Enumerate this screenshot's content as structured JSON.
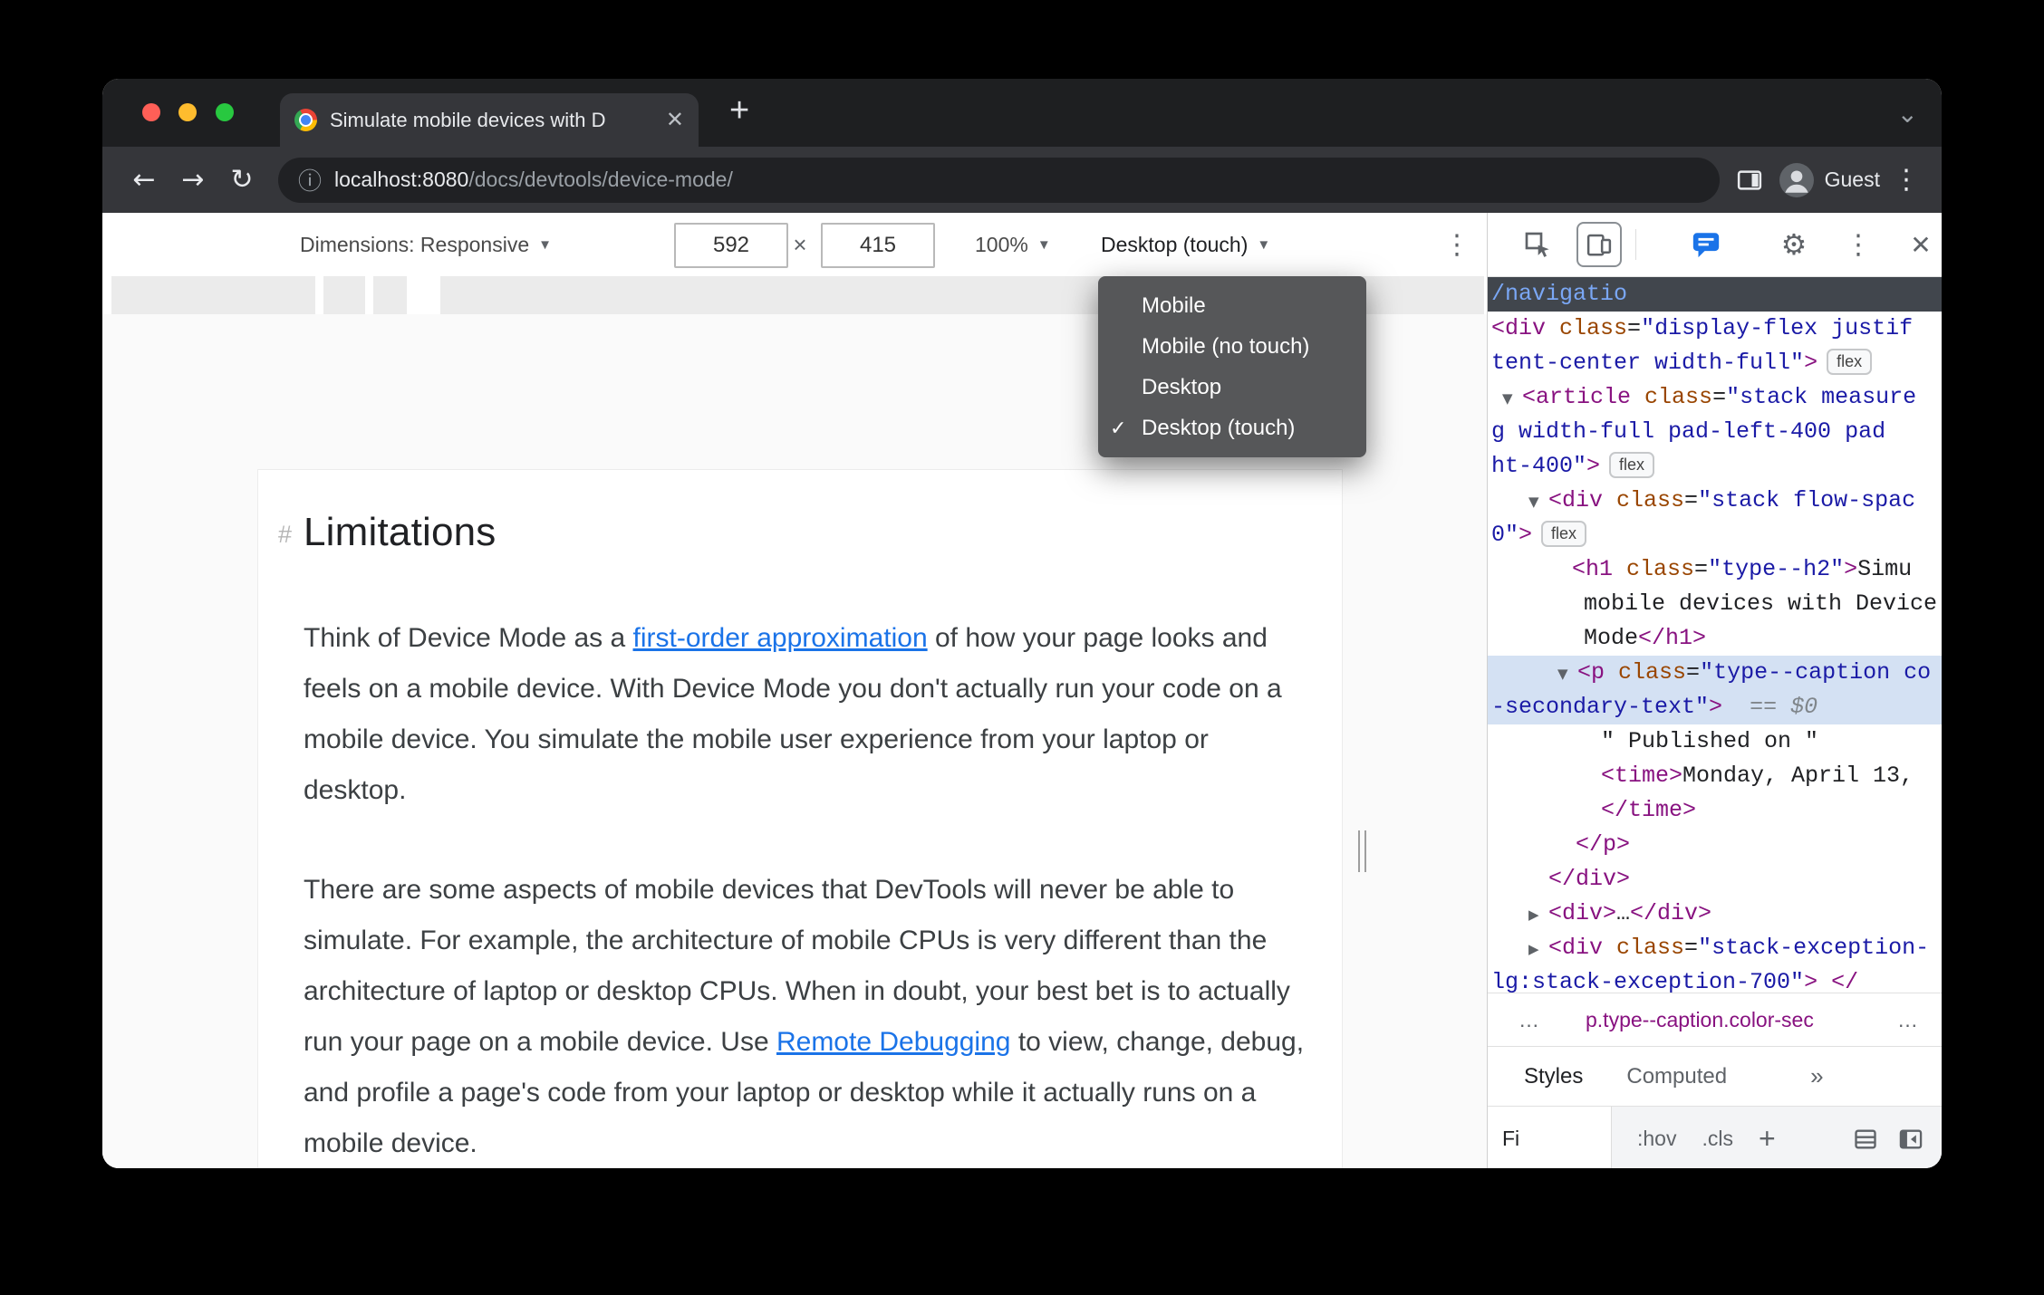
{
  "icons": {
    "close": "✕",
    "plus": "+",
    "chevron_down": "⌄",
    "back": "←",
    "forward": "→",
    "reload": "↻",
    "kebab": "⋮",
    "info": "ⓘ",
    "caret": "▾",
    "gear": "⚙",
    "check": "✓",
    "ellipsis": "…",
    "times_small": "✕"
  },
  "window": {
    "tab_title": "Simulate mobile devices with D",
    "url_host": "localhost:8080",
    "url_path": "/docs/devtools/device-mode/",
    "guest_label": "Guest"
  },
  "device_toolbar": {
    "dimensions_label": "Dimensions: Responsive",
    "width_value": "592",
    "multiply": "×",
    "height_value": "415",
    "zoom_value": "100%",
    "device_type_value": "Desktop (touch)"
  },
  "dropdown": {
    "items": [
      {
        "label": "Mobile",
        "checked": false
      },
      {
        "label": "Mobile (no touch)",
        "checked": false
      },
      {
        "label": "Desktop",
        "checked": false
      },
      {
        "label": "Desktop (touch)",
        "checked": true
      }
    ]
  },
  "article": {
    "heading_hash": "#",
    "heading": "Limitations",
    "p1_before": "Think of Device Mode as a ",
    "p1_link": "first-order approximation",
    "p1_after": " of how your page looks and feels on a mobile device. With Device Mode you don't actually run your code on a mobile device. You simulate the mobile user experience from your laptop or desktop.",
    "p2_before": "There are some aspects of mobile devices that DevTools will never be able to simulate. For example, the architecture of mobile CPUs is very different than the architecture of laptop or desktop CPUs. When in doubt, your best bet is to actually run your page on a mobile device. Use ",
    "p2_link": "Remote Debugging",
    "p2_after": " to view, change, debug, and profile a page's code from your laptop or desktop while it actually runs on a mobile device."
  },
  "elements_panel": {
    "colors": {
      "tag": "#881280",
      "attribute": "#994500",
      "value": "#1a1aa6",
      "selected_bg": "#d4e1f3",
      "accent": "#1a73e8"
    },
    "rows": [
      {
        "i": 4,
        "dark": true,
        "segs": [
          [
            "d",
            "/navigatio"
          ]
        ]
      },
      {
        "i": 4,
        "segs": [
          [
            "g",
            "<div"
          ],
          [
            "p",
            " "
          ],
          [
            "a",
            "class"
          ],
          [
            "p",
            "="
          ],
          [
            "v",
            "\"display-flex justif"
          ]
        ]
      },
      {
        "i": 4,
        "segs": [
          [
            "v",
            "tent-center width-full\""
          ],
          [
            "g",
            ">"
          ]
        ],
        "badge": "flex"
      },
      {
        "i": 16,
        "ar": "▼",
        "segs": [
          [
            "g",
            "<article"
          ],
          [
            "p",
            " "
          ],
          [
            "a",
            "class"
          ],
          [
            "p",
            "="
          ],
          [
            "v",
            "\"stack measure"
          ]
        ]
      },
      {
        "i": 4,
        "segs": [
          [
            "v",
            "g width-full pad-left-400 pad"
          ]
        ]
      },
      {
        "i": 4,
        "segs": [
          [
            "v",
            "ht-400\""
          ],
          [
            "g",
            ">"
          ]
        ],
        "badge": "flex"
      },
      {
        "i": 45,
        "ar": "▼",
        "segs": [
          [
            "g",
            "<div"
          ],
          [
            "p",
            " "
          ],
          [
            "a",
            "class"
          ],
          [
            "p",
            "="
          ],
          [
            "v",
            "\"stack flow-spac"
          ]
        ]
      },
      {
        "i": 4,
        "segs": [
          [
            "v",
            "0\""
          ],
          [
            "g",
            ">"
          ]
        ],
        "badge": "flex"
      },
      {
        "i": 93,
        "segs": [
          [
            "g",
            "<h1"
          ],
          [
            "p",
            " "
          ],
          [
            "a",
            "class"
          ],
          [
            "p",
            "="
          ],
          [
            "v",
            "\"type--h2\""
          ],
          [
            "g",
            ">"
          ],
          [
            "t",
            "Simu"
          ]
        ]
      },
      {
        "i": 106,
        "segs": [
          [
            "t",
            "mobile devices with Device"
          ]
        ]
      },
      {
        "i": 106,
        "segs": [
          [
            "t",
            "Mode"
          ],
          [
            "g",
            "</h1>"
          ]
        ]
      },
      {
        "i": 77,
        "ar": "▼",
        "sel": true,
        "segs": [
          [
            "g",
            "<p"
          ],
          [
            "p",
            " "
          ],
          [
            "a",
            "class"
          ],
          [
            "p",
            "="
          ],
          [
            "v",
            "\"type--caption co"
          ]
        ]
      },
      {
        "i": 4,
        "sel": true,
        "segs": [
          [
            "v",
            "-secondary-text\""
          ],
          [
            "g",
            ">"
          ],
          [
            "e",
            "  == $0"
          ]
        ]
      },
      {
        "i": 125,
        "segs": [
          [
            "t",
            "\" Published on \""
          ]
        ]
      },
      {
        "i": 125,
        "segs": [
          [
            "g",
            "<time>"
          ],
          [
            "t",
            "Monday, April 13,"
          ]
        ]
      },
      {
        "i": 125,
        "segs": [
          [
            "g",
            "</time>"
          ]
        ]
      },
      {
        "i": 97,
        "segs": [
          [
            "g",
            "</p>"
          ]
        ]
      },
      {
        "i": 67,
        "segs": [
          [
            "g",
            "</div>"
          ]
        ]
      },
      {
        "i": 45,
        "ar": "▶",
        "segs": [
          [
            "g",
            "<div>"
          ],
          [
            "t",
            "…"
          ],
          [
            "g",
            "</div>"
          ]
        ]
      },
      {
        "i": 45,
        "ar": "▶",
        "segs": [
          [
            "g",
            "<div"
          ],
          [
            "p",
            " "
          ],
          [
            "a",
            "class"
          ],
          [
            "p",
            "="
          ],
          [
            "v",
            "\"stack-exception-"
          ]
        ]
      },
      {
        "i": 4,
        "segs": [
          [
            "v",
            "lg:stack-exception-700\""
          ],
          [
            "g",
            ">"
          ],
          [
            "p",
            " "
          ],
          [
            "g",
            "</"
          ]
        ]
      }
    ],
    "breadcrumb": {
      "left_ellipsis": "…",
      "crumb": "p.type--caption.color-sec",
      "right_ellipsis": "…"
    },
    "tabs": {
      "styles": "Styles",
      "computed": "Computed",
      "more": "»"
    },
    "filter": {
      "text": "Fi",
      "hov": ":hov",
      "cls": ".cls",
      "plus": "+"
    }
  }
}
